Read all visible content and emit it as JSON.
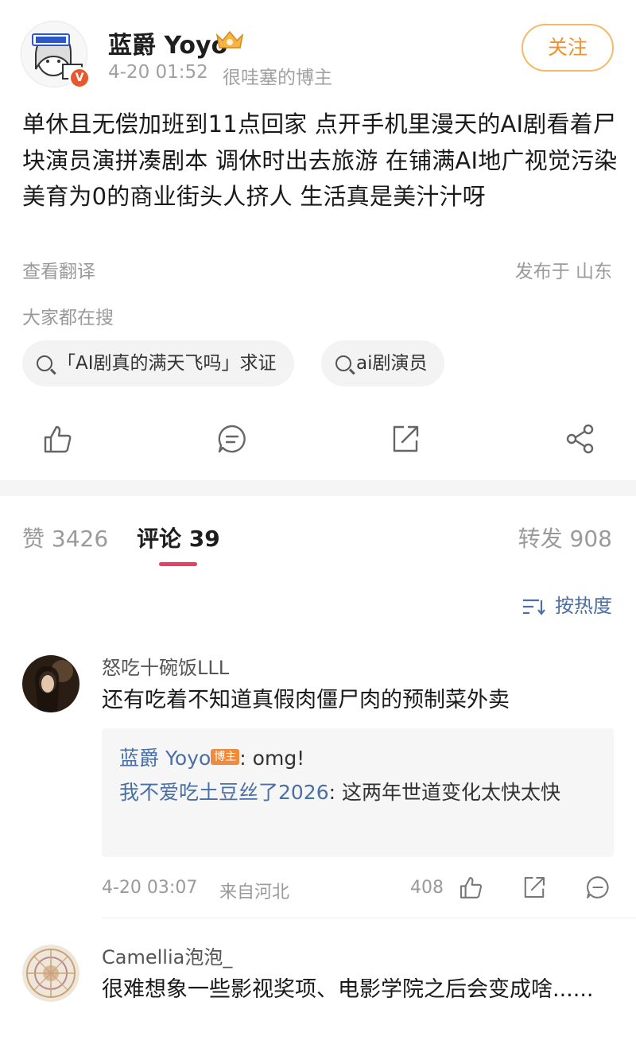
{
  "post": {
    "author": "蓝爵 Yoyo",
    "time": "4-20 01:52",
    "author_label": "很哇塞的博主",
    "follow_label": "关注",
    "text": "单休且无偿加班到11点回家 点开手机里漫天的AI剧看着尸块演员演拼凑剧本 调休时出去旅游 在铺满AI地广视觉污染美育为0的商业街头人挤人 生活真是美汁汁呀",
    "translate_label": "查看翻译",
    "location": "发布于 山东"
  },
  "search": {
    "title": "大家都在搜",
    "chips": [
      "「AI剧真的满天飞吗」求证",
      "ai剧演员"
    ]
  },
  "tabs": {
    "likes": "赞 3426",
    "comments": "评论 39",
    "reposts": "转发 908"
  },
  "sort_label": "按热度",
  "comments": [
    {
      "name": "怒吃十碗饭LLL",
      "text": "还有吃着不知道真假肉僵尸肉的预制菜外卖",
      "replies": [
        {
          "name": "蓝爵 Yoyo",
          "tag": "博主",
          "text": ": omg!"
        },
        {
          "name": "我不爱吃土豆丝了2026",
          "text": ": 这两年世道变化太快太快"
        }
      ],
      "time": "4-20 03:07",
      "location": "来自河北",
      "likes": "408"
    },
    {
      "name": "Camellia泡泡_",
      "text": "很难想象一些影视奖项、电影学院之后会变成啥......"
    }
  ],
  "colors": {
    "accent_orange": "#f0902e",
    "link_blue": "#4a6fa5",
    "tab_underline": "#ea3f63"
  }
}
